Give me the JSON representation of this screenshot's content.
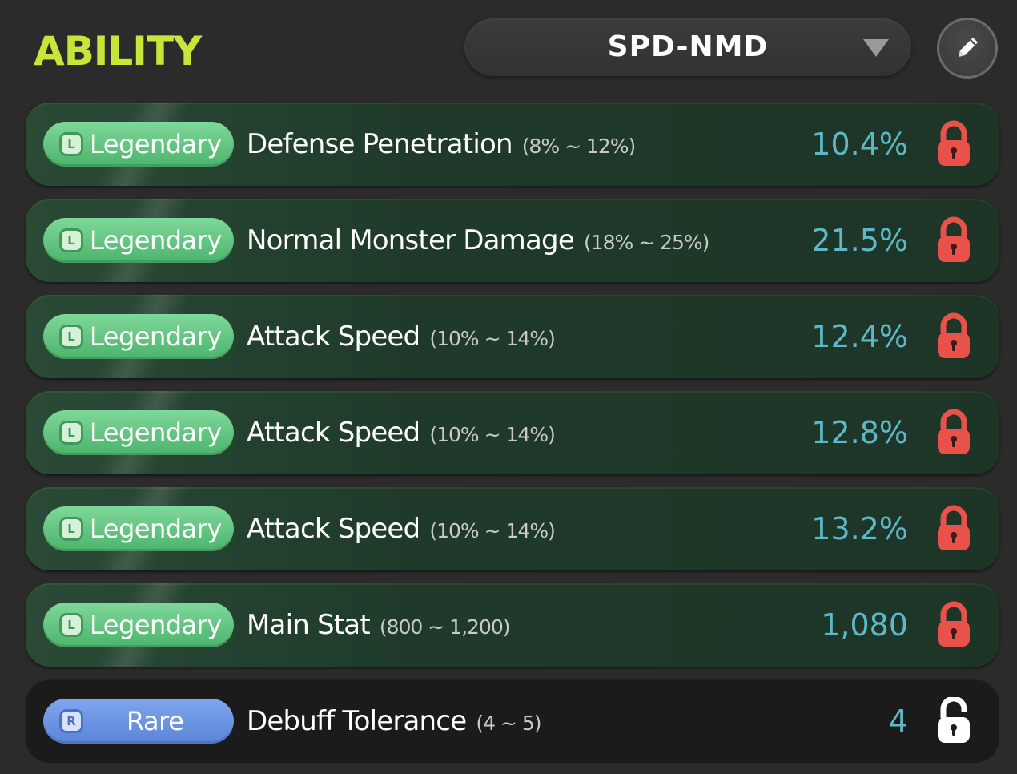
{
  "header": {
    "title": "ABILITY",
    "preset": "SPD-NMD",
    "dropdown_icon": "chevron-down-icon",
    "edit_icon": "pencil-icon"
  },
  "colors": {
    "title": "#c7e63a",
    "legendary_badge": "#5cc47b",
    "rare_badge": "#6b93e3",
    "value_text": "#5fb8c8",
    "locked": "#e8524a",
    "unlocked": "#ffffff"
  },
  "abilities": [
    {
      "grade": "Legendary",
      "grade_icon": "L",
      "name": "Defense Penetration",
      "range": "(8% ~ 12%)",
      "value": "10.4%",
      "lock": "locked"
    },
    {
      "grade": "Legendary",
      "grade_icon": "L",
      "name": "Normal Monster Damage",
      "range": "(18% ~ 25%)",
      "value": "21.5%",
      "lock": "locked"
    },
    {
      "grade": "Legendary",
      "grade_icon": "L",
      "name": "Attack Speed",
      "range": "(10% ~ 14%)",
      "value": "12.4%",
      "lock": "locked"
    },
    {
      "grade": "Legendary",
      "grade_icon": "L",
      "name": "Attack Speed",
      "range": "(10% ~ 14%)",
      "value": "12.8%",
      "lock": "locked"
    },
    {
      "grade": "Legendary",
      "grade_icon": "L",
      "name": "Attack Speed",
      "range": "(10% ~ 14%)",
      "value": "13.2%",
      "lock": "locked"
    },
    {
      "grade": "Legendary",
      "grade_icon": "L",
      "name": "Main Stat",
      "range": "(800 ~ 1,200)",
      "value": "1,080",
      "lock": "locked"
    },
    {
      "grade": "Rare",
      "grade_icon": "R",
      "name": "Debuff Tolerance",
      "range": "(4 ~ 5)",
      "value": "4",
      "lock": "unlocked"
    }
  ]
}
